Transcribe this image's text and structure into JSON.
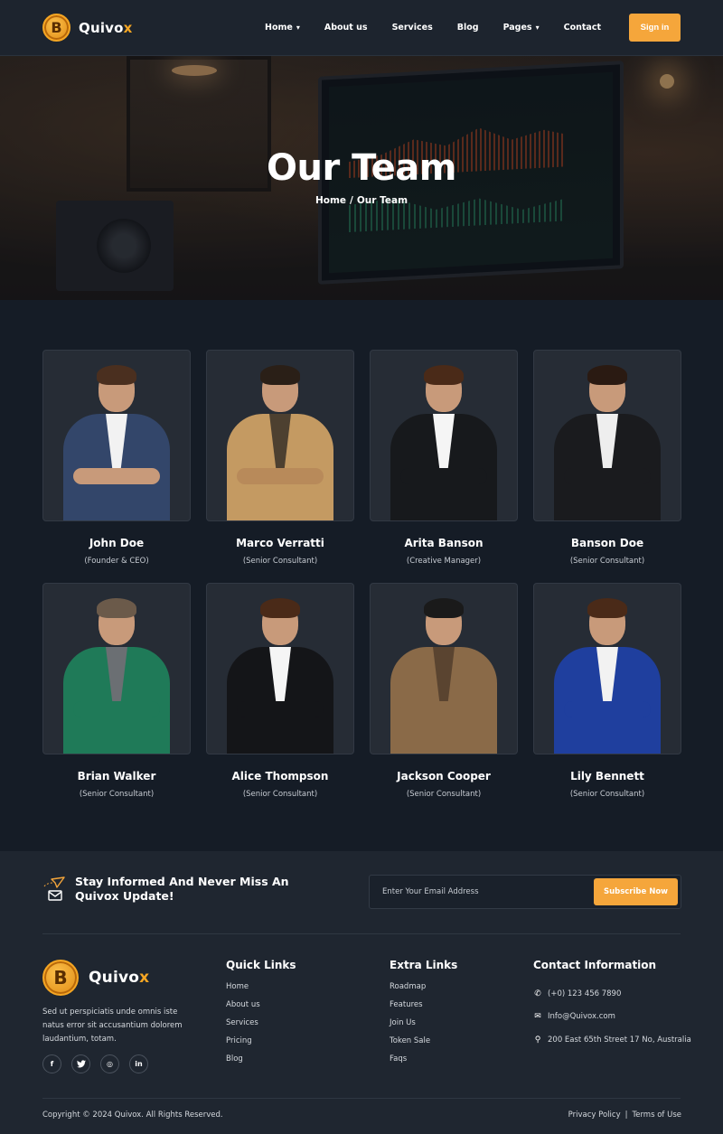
{
  "header": {
    "brand_main": "Quivo",
    "brand_accent": "x",
    "nav": [
      {
        "label": "Home",
        "dropdown": true
      },
      {
        "label": "About us",
        "dropdown": false
      },
      {
        "label": "Services",
        "dropdown": false
      },
      {
        "label": "Blog",
        "dropdown": false
      },
      {
        "label": "Pages",
        "dropdown": true
      },
      {
        "label": "Contact",
        "dropdown": false
      }
    ],
    "signin_label": "Sign in"
  },
  "hero": {
    "title": "Our Team",
    "breadcrumb": {
      "home": "Home",
      "separator": "/",
      "current": "Our Team"
    }
  },
  "team": [
    {
      "name": "John Doe",
      "role": "(Founder & CEO)"
    },
    {
      "name": "Marco Verratti",
      "role": "(Senior Consultant)"
    },
    {
      "name": "Arita Banson",
      "role": "(Creative Manager)"
    },
    {
      "name": "Banson Doe",
      "role": "(Senior Consultant)"
    },
    {
      "name": "Brian Walker",
      "role": "(Senior Consultant)"
    },
    {
      "name": "Alice Thompson",
      "role": "(Senior Consultant)"
    },
    {
      "name": "Jackson Cooper",
      "role": "(Senior Consultant)"
    },
    {
      "name": "Lily Bennett",
      "role": "(Senior Consultant)"
    }
  ],
  "newsletter": {
    "heading": "Stay Informed And Never Miss An Quivox Update!",
    "placeholder": "Enter Your Email Address",
    "button_label": "Subscribe Now",
    "icon": "paper-plane-envelope-icon"
  },
  "footer": {
    "about": "Sed ut perspiciatis unde omnis iste natus error sit accusantium dolorem laudantium, totam.",
    "socials": [
      {
        "icon": "facebook-icon",
        "glyph": "f"
      },
      {
        "icon": "twitter-icon",
        "glyph": "t"
      },
      {
        "icon": "instagram-icon",
        "glyph": "◎"
      },
      {
        "icon": "linkedin-icon",
        "glyph": "in"
      }
    ],
    "quick_links": {
      "title": "Quick Links",
      "items": [
        "Home",
        "About us",
        "Services",
        "Pricing",
        "Blog"
      ]
    },
    "extra_links": {
      "title": "Extra Links",
      "items": [
        "Roadmap",
        "Features",
        "Join Us",
        "Token Sale",
        "Faqs"
      ]
    },
    "contact": {
      "title": "Contact Information",
      "phone": "(+0) 123 456 7890",
      "email": "Info@Quivox.com",
      "address": "200 East 65th Street 17 No, Australia"
    },
    "copyright": "Copyright © 2024 Quivox. All Rights Reserved.",
    "privacy": "Privacy Policy",
    "legal_sep": "|",
    "terms": "Terms of Use"
  },
  "colors": {
    "accent": "#f5a63b",
    "background": "#151c26",
    "card": "#262c35"
  }
}
